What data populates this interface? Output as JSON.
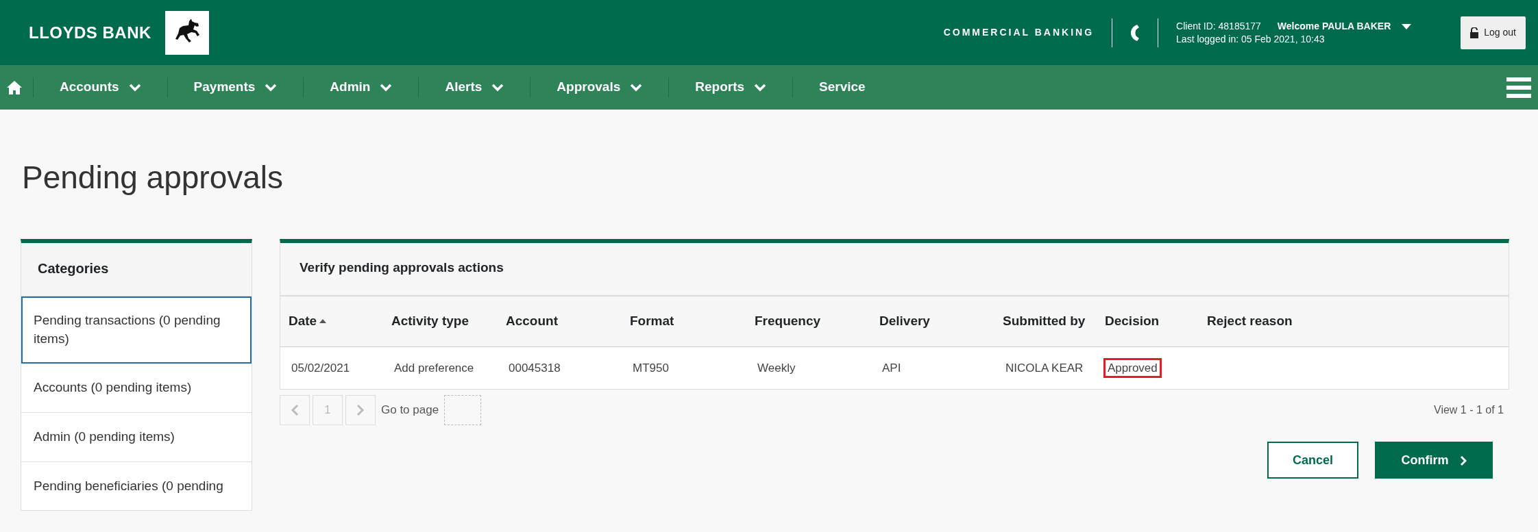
{
  "header": {
    "brand": "LLOYDS BANK",
    "division": "COMMERCIAL BANKING",
    "client_id": "Client ID: 48185177",
    "welcome": "Welcome PAULA BAKER",
    "last_logged_in": "Last logged in: 05 Feb 2021, 10:43",
    "logout": "Log out"
  },
  "nav": {
    "items": [
      {
        "label": "Accounts",
        "dropdown": true
      },
      {
        "label": "Payments",
        "dropdown": true
      },
      {
        "label": "Admin",
        "dropdown": true
      },
      {
        "label": "Alerts",
        "dropdown": true
      },
      {
        "label": "Approvals",
        "dropdown": true
      },
      {
        "label": "Reports",
        "dropdown": true
      },
      {
        "label": "Service",
        "dropdown": false
      }
    ]
  },
  "page_title": "Pending approvals",
  "sidebar": {
    "title": "Categories",
    "items": [
      {
        "label": "Pending transactions (0 pending items)",
        "selected": true
      },
      {
        "label": "Accounts (0 pending items)",
        "selected": false
      },
      {
        "label": "Admin (0 pending items)",
        "selected": false
      },
      {
        "label": "Pending beneficiaries (0 pending",
        "selected": false
      }
    ]
  },
  "table": {
    "title": "Verify pending approvals actions",
    "columns": [
      {
        "label": "Date",
        "sorted": true
      },
      {
        "label": "Activity type",
        "sorted": false
      },
      {
        "label": "Account",
        "sorted": false
      },
      {
        "label": "Format",
        "sorted": false
      },
      {
        "label": "Frequency",
        "sorted": false
      },
      {
        "label": "Delivery",
        "sorted": false
      },
      {
        "label": "Submitted by",
        "sorted": false
      },
      {
        "label": "Decision",
        "sorted": false
      },
      {
        "label": "Reject reason",
        "sorted": false
      }
    ],
    "rows": [
      {
        "cells": [
          {
            "text": "05/02/2021",
            "highlighted": false
          },
          {
            "text": "Add preference",
            "highlighted": false
          },
          {
            "text": "00045318",
            "highlighted": false
          },
          {
            "text": "MT950",
            "highlighted": false
          },
          {
            "text": "Weekly",
            "highlighted": false
          },
          {
            "text": "API",
            "highlighted": false
          },
          {
            "text": "NICOLA KEAR",
            "highlighted": false
          },
          {
            "text": "Approved",
            "highlighted": true
          }
        ]
      }
    ]
  },
  "pagination": {
    "page": "1",
    "go_to_page": "Go to page",
    "view": "View 1 - 1 of 1"
  },
  "buttons": [
    {
      "label": "Cancel",
      "kind": "secondary"
    },
    {
      "label": "Confirm",
      "kind": "primary"
    }
  ]
}
